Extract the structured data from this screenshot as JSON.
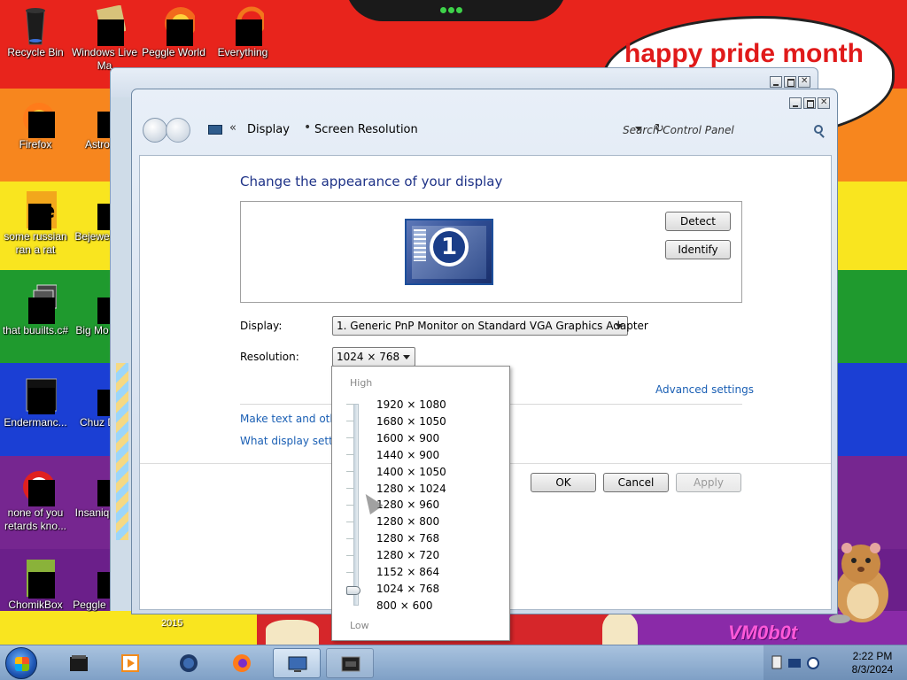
{
  "desktop": {
    "bubble_text": "happy pride month",
    "signature": "VM0b0t",
    "year_text": "2015",
    "icons": [
      {
        "label": "Recycle Bin"
      },
      {
        "label": "Windows Live Ma"
      },
      {
        "label": "Peggle World"
      },
      {
        "label": "Everything"
      },
      {
        "label": "Firefox"
      },
      {
        "label": "Astrok Delu"
      },
      {
        "label": "some russian ran a rat"
      },
      {
        "label": "Bejewe Delu"
      },
      {
        "label": "that buuilts.c#"
      },
      {
        "label": "Big Mo Delu"
      },
      {
        "label": "Endermanc..."
      },
      {
        "label": "Chuz Delu"
      },
      {
        "label": "none of you retards kno..."
      },
      {
        "label": "Insaniq Delu"
      },
      {
        "label": "ChomikBox"
      },
      {
        "label": "Peggle Delux"
      }
    ]
  },
  "window": {
    "breadcrumb": [
      "Display",
      "Screen Resolution"
    ],
    "search_placeholder": "Search Control Panel",
    "heading": "Change the appearance of your display",
    "monitor_number": "1",
    "detect_label": "Detect",
    "identify_label": "Identify",
    "display_label": "Display:",
    "display_value": "1. Generic PnP Monitor on Standard VGA Graphics Adapter",
    "resolution_label": "Resolution:",
    "resolution_value": "1024 × 768",
    "advanced_link": "Advanced settings",
    "link_text_size": "Make text and other",
    "link_settings": "What display setting",
    "ok_label": "OK",
    "cancel_label": "Cancel",
    "apply_label": "Apply"
  },
  "resolution_dropdown": {
    "high_label": "High",
    "low_label": "Low",
    "options": [
      "1920 × 1080",
      "1680 × 1050",
      "1600 × 900",
      "1440 × 900",
      "1400 × 1050",
      "1280 × 1024",
      "1280 × 960",
      "1280 × 800",
      "1280 × 768",
      "1280 × 720",
      "1152 × 864",
      "1024 × 768",
      "800 × 600"
    ],
    "selected_index": 11
  },
  "taskbar": {
    "time": "2:22 PM",
    "date": "8/3/2024"
  }
}
